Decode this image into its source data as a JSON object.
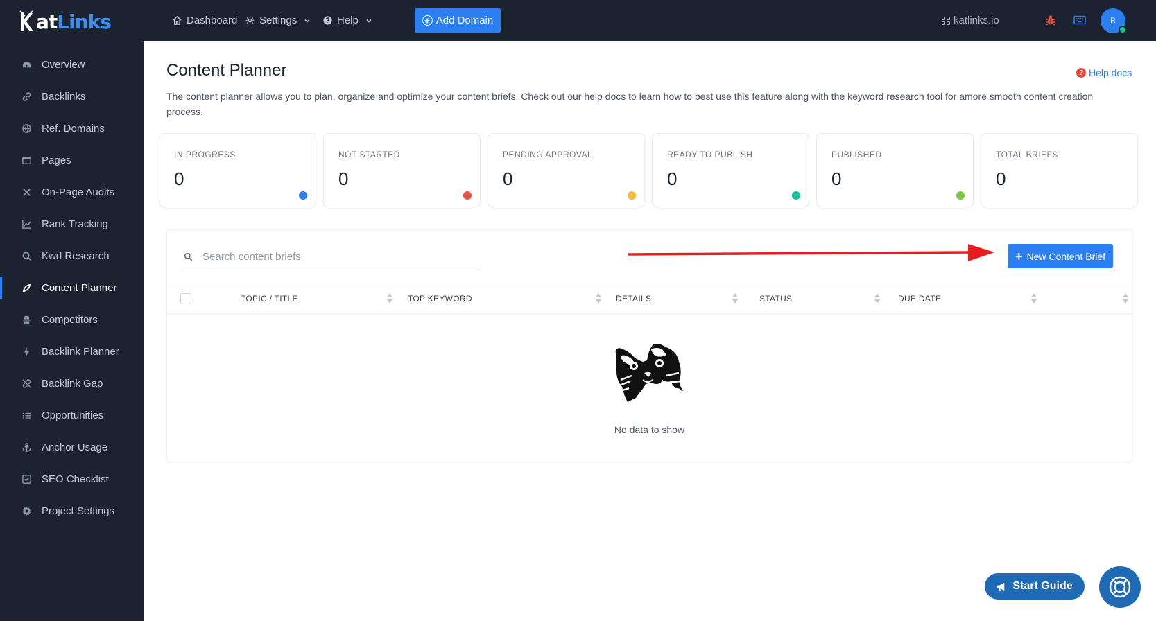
{
  "brand": {
    "logo_text_a": "atLinks",
    "logo_text_b": ""
  },
  "sidebar": {
    "items": [
      {
        "label": "Overview",
        "icon": "gauge-icon"
      },
      {
        "label": "Backlinks",
        "icon": "link-icon"
      },
      {
        "label": "Ref. Domains",
        "icon": "globe-icon"
      },
      {
        "label": "Pages",
        "icon": "window-icon"
      },
      {
        "label": "On-Page Audits",
        "icon": "tools-icon"
      },
      {
        "label": "Rank Tracking",
        "icon": "chart-line-icon"
      },
      {
        "label": "Kwd Research",
        "icon": "search-icon"
      },
      {
        "label": "Content Planner",
        "icon": "content-icon",
        "active": true
      },
      {
        "label": "Competitors",
        "icon": "spy-icon"
      },
      {
        "label": "Backlink Planner",
        "icon": "bolt-icon"
      },
      {
        "label": "Backlink Gap",
        "icon": "unlink-icon"
      },
      {
        "label": "Opportunities",
        "icon": "list-icon"
      },
      {
        "label": "Anchor Usage",
        "icon": "anchor-icon"
      },
      {
        "label": "SEO Checklist",
        "icon": "checkbox-icon"
      },
      {
        "label": "Project Settings",
        "icon": "gear-icon"
      }
    ]
  },
  "topbar": {
    "dashboard": "Dashboard",
    "settings": "Settings",
    "help": "Help",
    "add_domain": "Add Domain",
    "domain": "katlinks.io",
    "avatar_initial": "R"
  },
  "page": {
    "title": "Content Planner",
    "help_docs": "Help docs",
    "description": "The content planner allows you to plan, organize and optimize your content briefs. Check out our help docs to learn how to best use this feature along with the keyword research tool for amore smooth content creation process."
  },
  "stats": [
    {
      "label": "IN PROGRESS",
      "value": "0",
      "color": "#2b7ff0"
    },
    {
      "label": "NOT STARTED",
      "value": "0",
      "color": "#e8533f"
    },
    {
      "label": "PENDING APPROVAL",
      "value": "0",
      "color": "#f5b838"
    },
    {
      "label": "READY TO PUBLISH",
      "value": "0",
      "color": "#14c3a0"
    },
    {
      "label": "PUBLISHED",
      "value": "0",
      "color": "#7cc740"
    },
    {
      "label": "TOTAL BRIEFS",
      "value": "0",
      "color": ""
    }
  ],
  "table": {
    "search_placeholder": "Search content briefs",
    "new_button": "New Content Brief",
    "columns": [
      "TOPIC / TITLE",
      "TOP KEYWORD",
      "DETAILS",
      "STATUS",
      "DUE DATE"
    ],
    "empty_text": "No data to show"
  },
  "footer": {
    "start_guide": "Start Guide"
  },
  "colors": {
    "accent": "#2b7ff0",
    "sidebar_bg": "#1b2230",
    "arrow": "#e81c1c"
  }
}
